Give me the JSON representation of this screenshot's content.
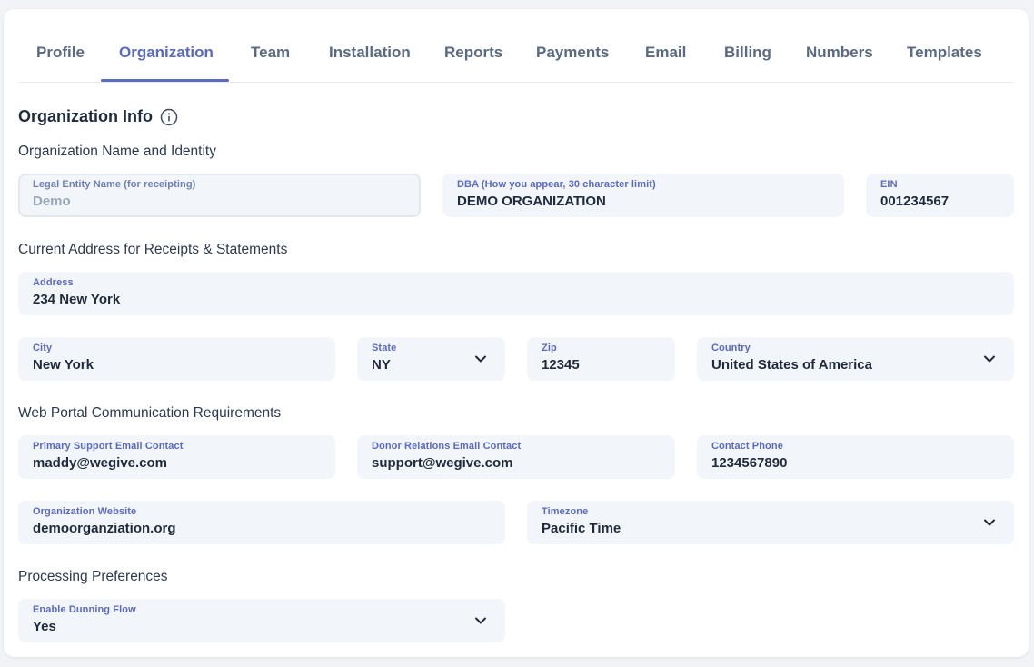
{
  "tabs": [
    {
      "label": "Profile"
    },
    {
      "label": "Organization"
    },
    {
      "label": "Team"
    },
    {
      "label": "Installation"
    },
    {
      "label": "Reports"
    },
    {
      "label": "Payments"
    },
    {
      "label": "Email"
    },
    {
      "label": "Billing"
    },
    {
      "label": "Numbers"
    },
    {
      "label": "Templates"
    }
  ],
  "active_tab": "Organization",
  "section_title": "Organization Info",
  "headings": {
    "identity": "Organization Name and Identity",
    "address": "Current Address for Receipts & Statements",
    "communication": "Web Portal Communication Requirements",
    "processing": "Processing Preferences"
  },
  "fields": {
    "legal_name": {
      "label": "Legal Entity Name (for receipting)",
      "value": "Demo"
    },
    "dba": {
      "label": "DBA (How you appear, 30 character limit)",
      "value": "DEMO ORGANIZATION"
    },
    "ein": {
      "label": "EIN",
      "value": "001234567"
    },
    "address": {
      "label": "Address",
      "value": "234 New York"
    },
    "city": {
      "label": "City",
      "value": "New York"
    },
    "state": {
      "label": "State",
      "value": "NY"
    },
    "zip": {
      "label": "Zip",
      "value": "12345"
    },
    "country": {
      "label": "Country",
      "value": "United States of America"
    },
    "support_email": {
      "label": "Primary Support Email Contact",
      "value": "maddy@wegive.com"
    },
    "donor_email": {
      "label": "Donor Relations Email Contact",
      "value": "support@wegive.com"
    },
    "phone": {
      "label": "Contact Phone",
      "value": "1234567890"
    },
    "website": {
      "label": "Organization Website",
      "value": "demoorganziation.org"
    },
    "timezone": {
      "label": "Timezone",
      "value": "Pacific Time"
    },
    "dunning": {
      "label": "Enable Dunning Flow",
      "value": "Yes"
    }
  },
  "colors": {
    "accent": "#5b6abf",
    "field_bg": "#f2f5f9",
    "text": "#1f2a3c"
  }
}
